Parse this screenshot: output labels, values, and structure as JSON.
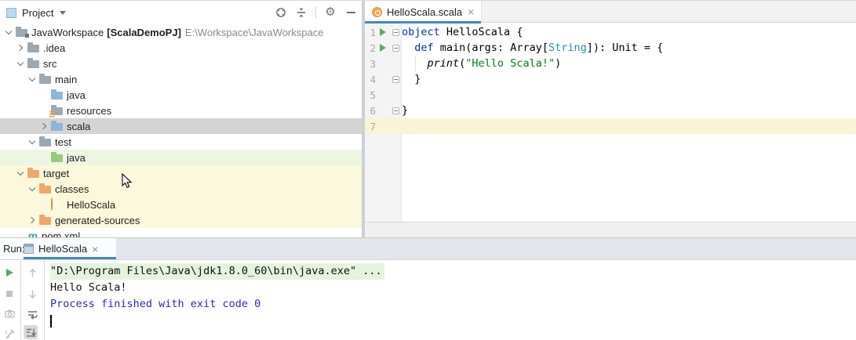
{
  "icons": {
    "gear": "⚙",
    "close": "×",
    "maven": "m"
  },
  "colors": {
    "accent_blue": "#4285c9",
    "keyword": "#0033b3",
    "string_literal": "#067d17",
    "caret_row": "#faf3d6",
    "tree_selected": "#d4d4d4",
    "tree_green_row": "#edf6e3",
    "tree_yellow_row": "#fbf8dc",
    "run_green": "#59a869",
    "console_cmd_bg": "#e4f2de",
    "console_system": "#2929c4",
    "folder_orange": "#eca96f"
  },
  "project_panel": {
    "title": "Project",
    "tree": [
      {
        "label": "JavaWorkspace",
        "bracket": "[ScalaDemoPJ]",
        "path": "E:\\Workspace\\JavaWorkspace"
      },
      {
        "label": ".idea"
      },
      {
        "label": "src"
      },
      {
        "label": "main"
      },
      {
        "label": "java"
      },
      {
        "label": "resources"
      },
      {
        "label": "scala"
      },
      {
        "label": "test"
      },
      {
        "label": "java"
      },
      {
        "label": "target"
      },
      {
        "label": "classes"
      },
      {
        "label": "HelloScala"
      },
      {
        "label": "generated-sources"
      },
      {
        "label": "pom.xml"
      }
    ]
  },
  "editor": {
    "tab": {
      "title": "HelloScala.scala"
    },
    "lines": [
      {
        "num": "1",
        "tokens": [
          {
            "c": "kw",
            "t": "object"
          },
          {
            "c": "pl",
            "t": " HelloScala {"
          }
        ]
      },
      {
        "num": "2",
        "tokens": [
          {
            "c": "pl",
            "t": "  "
          },
          {
            "c": "kw",
            "t": "def"
          },
          {
            "c": "pl",
            "t": " main(args: Array["
          },
          {
            "c": "type",
            "t": "String"
          },
          {
            "c": "pl",
            "t": "]): Unit = {"
          }
        ]
      },
      {
        "num": "3",
        "tokens": [
          {
            "c": "pl",
            "t": "    "
          },
          {
            "c": "fn",
            "t": "print"
          },
          {
            "c": "pl",
            "t": "("
          },
          {
            "c": "str",
            "t": "\"Hello Scala!\""
          },
          {
            "c": "pl",
            "t": ")"
          }
        ]
      },
      {
        "num": "4",
        "tokens": [
          {
            "c": "pl",
            "t": "  }"
          }
        ]
      },
      {
        "num": "5",
        "tokens": []
      },
      {
        "num": "6",
        "tokens": [
          {
            "c": "pl",
            "t": "}"
          }
        ]
      },
      {
        "num": "7",
        "tokens": []
      }
    ]
  },
  "run_panel": {
    "label": "Run:",
    "tab": {
      "title": "HelloScala"
    },
    "console": [
      "\"D:\\Program Files\\Java\\jdk1.8.0_60\\bin\\java.exe\" ...",
      "Hello Scala!",
      "Process finished with exit code 0"
    ]
  }
}
